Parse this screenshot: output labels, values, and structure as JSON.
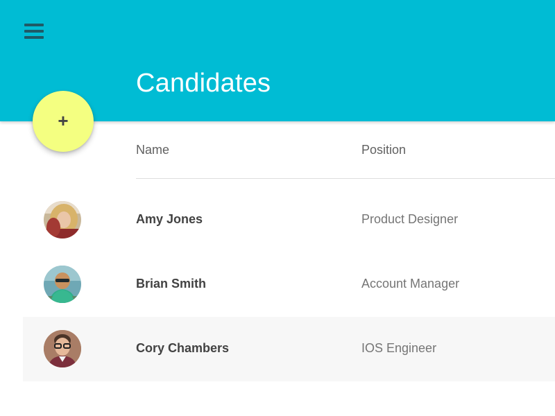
{
  "header": {
    "title": "Candidates",
    "menu_icon": "hamburger-menu-icon",
    "background_color": "#00BCD4"
  },
  "fab": {
    "label": "+",
    "icon": "add-icon",
    "color": "#F4FF81"
  },
  "table": {
    "columns": [
      "Name",
      "Position"
    ],
    "rows": [
      {
        "name": "Amy Jones",
        "position": "Product Designer",
        "avatar": "avatar-photo"
      },
      {
        "name": "Brian Smith",
        "position": "Account Manager",
        "avatar": "avatar-photo"
      },
      {
        "name": "Cory Chambers",
        "position": "IOS Engineer",
        "avatar": "avatar-photo",
        "highlighted": true
      }
    ]
  }
}
